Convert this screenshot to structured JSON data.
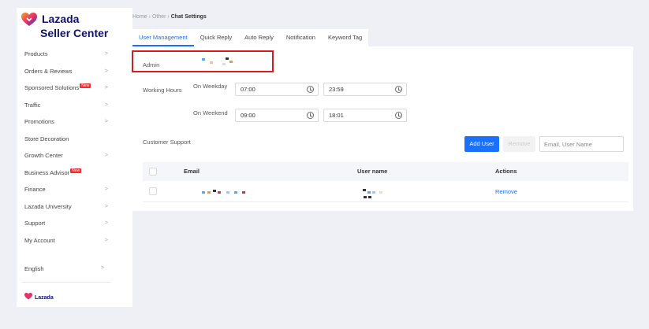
{
  "brand": {
    "name": "Lazada",
    "sub": "Seller Center",
    "footer": "Lazada"
  },
  "sidebar": {
    "items": [
      {
        "label": "Products",
        "chevron": ">"
      },
      {
        "label": "Orders & Reviews",
        "chevron": ">"
      },
      {
        "label": "Sponsored Solutions",
        "badge": "New",
        "chevron": ">"
      },
      {
        "label": "Traffic",
        "chevron": ">"
      },
      {
        "label": "Promotions",
        "chevron": ">"
      },
      {
        "label": "Store Decoration",
        "chevron": ""
      },
      {
        "label": "Growth Center",
        "chevron": ">"
      },
      {
        "label": "Business Advisor",
        "badge": "New",
        "chevron": ""
      },
      {
        "label": "Finance",
        "chevron": ">"
      },
      {
        "label": "Lazada University",
        "chevron": ">"
      },
      {
        "label": "Support",
        "chevron": ">"
      },
      {
        "label": "My Account",
        "chevron": ">"
      }
    ],
    "language": "English",
    "language_chevron": ">"
  },
  "breadcrumb": {
    "home": "Home",
    "sep": "›",
    "other": "Other",
    "current": "Chat Settings"
  },
  "tabs": [
    "User Management",
    "Quick Reply",
    "Auto Reply",
    "Notification",
    "Keyword Tag"
  ],
  "admin": {
    "label": "Admin"
  },
  "working_hours": {
    "label": "Working Hours",
    "weekday_label": "On Weekday",
    "weekday_start": "07:00",
    "weekday_end": "23:59",
    "weekend_label": "On Weekend",
    "weekend_start": "09:00",
    "weekend_end": "18:01"
  },
  "support": {
    "label": "Customer Support",
    "add_button": "Add User",
    "remove_button": "Remove",
    "search_placeholder": "Email, User Name"
  },
  "table": {
    "headers": {
      "email": "Email",
      "username": "User name",
      "actions": "Actions"
    },
    "rows": [
      {
        "action": "Remove"
      }
    ]
  },
  "colors": {
    "accent": "#1a71ff",
    "highlight": "#d21f1f",
    "brand": "#0f136d"
  }
}
